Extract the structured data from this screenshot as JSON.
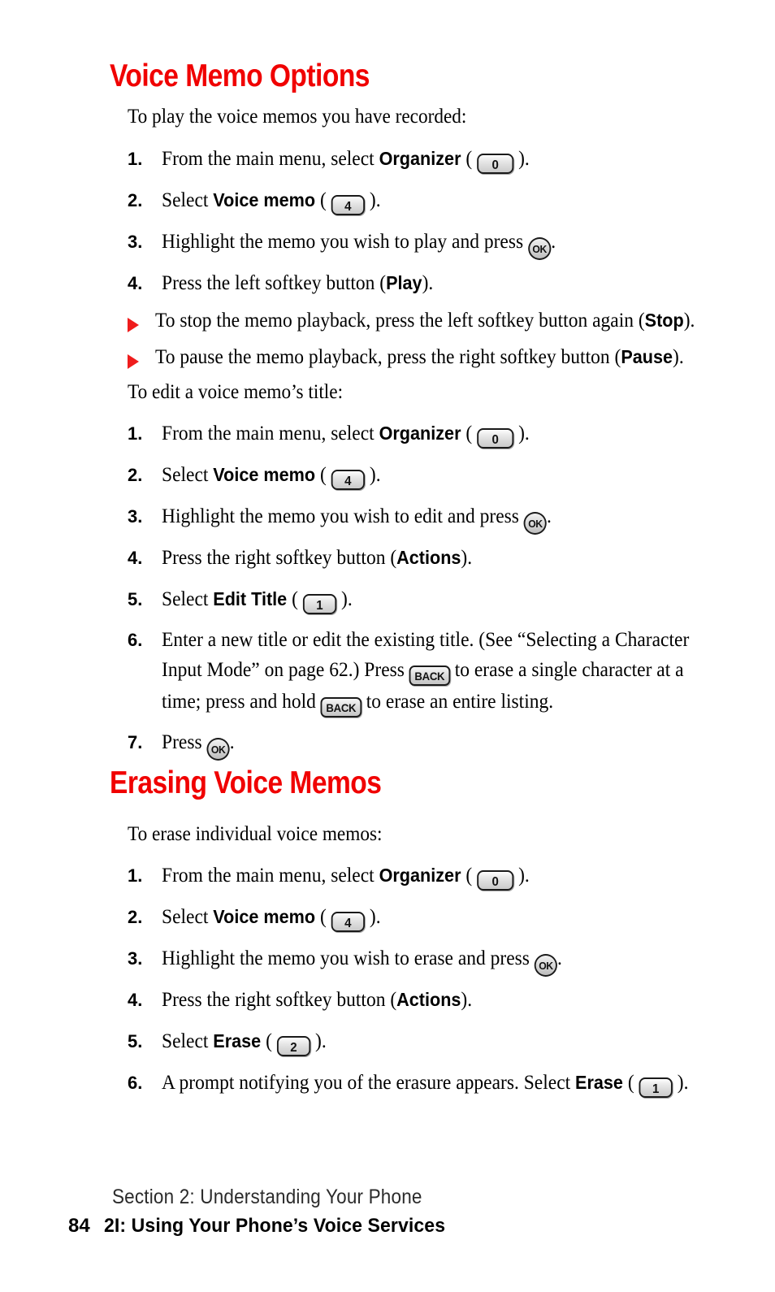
{
  "document": {
    "accent_color": "#f00000",
    "page_number": "84"
  },
  "sections": [
    {
      "heading": "Voice Memo Options",
      "lead": "To play the voice memos you have recorded:",
      "steps": [
        {
          "num": "1.",
          "pre": "From the main menu, select ",
          "bold": "Organizer",
          "open_paren": " ( ",
          "key": "0",
          "close_paren": " ).",
          "key_type": "num-wide"
        },
        {
          "num": "2.",
          "pre": "Select ",
          "bold": "Voice memo",
          "open_paren": " ( ",
          "key": "4",
          "close_paren": " ).",
          "key_type": "num"
        },
        {
          "num": "3.",
          "pre": "Highlight the memo you wish to play and press ",
          "key": "OK",
          "close_paren": ".",
          "key_type": "ok"
        },
        {
          "num": "4.",
          "pre": "Press the left softkey button (",
          "bold": "Play",
          "close_paren": ")."
        }
      ],
      "bullets": [
        {
          "pre": "To stop the memo playback, press the left softkey button again (",
          "bold": "Stop",
          "post": ")."
        },
        {
          "pre": "To pause the memo playback, press the right softkey button (",
          "bold": "Pause",
          "post": ")."
        }
      ]
    },
    {
      "lead": "To edit a voice memo’s title:",
      "steps": [
        {
          "num": "1.",
          "pre": "From the main menu, select ",
          "bold": "Organizer",
          "open_paren": " ( ",
          "key": "0",
          "close_paren": " ).",
          "key_type": "num-wide"
        },
        {
          "num": "2.",
          "pre": "Select ",
          "bold": "Voice memo",
          "open_paren": " ( ",
          "key": "4",
          "close_paren": " ).",
          "key_type": "num"
        },
        {
          "num": "3.",
          "pre": "Highlight the memo you wish to edit and press ",
          "key": "OK",
          "close_paren": ".",
          "key_type": "ok"
        },
        {
          "num": "4.",
          "pre": "Press the right softkey button (",
          "bold": "Actions",
          "close_paren": ")."
        },
        {
          "num": "5.",
          "pre": "Select ",
          "bold": "Edit Title",
          "open_paren": " ( ",
          "key": "1",
          "close_paren": " ).",
          "key_type": "num"
        },
        {
          "num": "6.",
          "line1": "Enter a new title or edit the existing title. (See “Selecting a Character",
          "line2a": "Input Mode” on page 62.) Press ",
          "key2": "BACK",
          "line2b": " to erase a single character at a",
          "line3a": "time; press and hold ",
          "key3": "BACK",
          "line3b": " to erase an entire listing."
        },
        {
          "num": "7.",
          "pre": "Press ",
          "key": "OK",
          "close_paren": ".",
          "key_type": "ok"
        }
      ]
    },
    {
      "heading": "Erasing Voice Memos",
      "lead": "To erase individual voice memos:",
      "steps": [
        {
          "num": "1.",
          "pre": "From the main menu, select ",
          "bold": "Organizer",
          "open_paren": " ( ",
          "key": "0",
          "close_paren": " ).",
          "key_type": "num-wide"
        },
        {
          "num": "2.",
          "pre": "Select ",
          "bold": "Voice memo",
          "open_paren": " ( ",
          "key": "4",
          "close_paren": " ).",
          "key_type": "num"
        },
        {
          "num": "3.",
          "pre": "Highlight the memo you wish to erase and press ",
          "key": "OK",
          "close_paren": ".",
          "key_type": "ok"
        },
        {
          "num": "4.",
          "pre": "Press the right softkey button (",
          "bold": "Actions",
          "close_paren": ")."
        },
        {
          "num": "5.",
          "pre": "Select ",
          "bold": "Erase",
          "open_paren": " ( ",
          "key": "2",
          "close_paren": " ).",
          "key_type": "num"
        },
        {
          "num": "6.",
          "pre": "A prompt notifying you of the erasure appears. Select ",
          "bold": "Erase",
          "open_paren": " ( ",
          "key": "1",
          "close_paren": " ).",
          "key_type": "num"
        }
      ]
    }
  ],
  "footer": {
    "section_line": "Section 2: Understanding Your Phone",
    "page_number": "84",
    "chapter_line": "2I: Using Your Phone’s Voice Services"
  }
}
